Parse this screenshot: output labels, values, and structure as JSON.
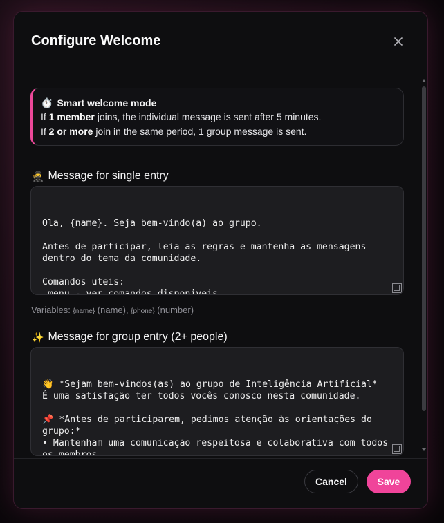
{
  "modal": {
    "title": "Configure Welcome",
    "close_icon": "close-icon"
  },
  "info": {
    "icon": "⏱️",
    "title": "Smart welcome mode",
    "line1_pre": "If ",
    "line1_bold": "1 member",
    "line1_post": " joins, the individual message is sent after 5 minutes.",
    "line2_pre": "If ",
    "line2_bold": "2 or more",
    "line2_post": " join in the same period, 1 group message is sent."
  },
  "single": {
    "icon": "🥷",
    "label": "Message for single entry",
    "text": "Ola, {name}. Seja bem-vindo(a) ao grupo.\n\nAntes de participar, leia as regras e mantenha as mensagens\ndentro do tema da comunidade.\n\nComandos uteis:\n.menu - ver comandos disponiveis\n.regras - consultar as regras\n.ajuda - pedir orientacao",
    "vars_prefix": "Variables: ",
    "var1_token": "{name}",
    "var1_desc": " (name), ",
    "var2_token": "{phone}",
    "var2_desc": " (number)"
  },
  "group": {
    "icon": "✨",
    "label": "Message for group entry (2+ people)",
    "text": "👋 *Sejam bem-vindos(as) ao grupo de Inteligência Artificial*\nÉ uma satisfação ter todos vocês conosco nesta comunidade.\n\n📌 *Antes de participarem, pedimos atenção às orientações do\ngrupo:*\n• Mantenham uma comunicação respeitosa e colaborativa com todos\nos membros\n• Evitem mensagens fora do contexto de inteligência artificial,\n  tecnologia e ferramentas MCP ou skills relacionadas"
  },
  "footer": {
    "cancel_label": "Cancel",
    "save_label": "Save"
  },
  "colors": {
    "accent": "#ec4899",
    "save_button": "#f0449a",
    "background": "#0e0e10"
  }
}
